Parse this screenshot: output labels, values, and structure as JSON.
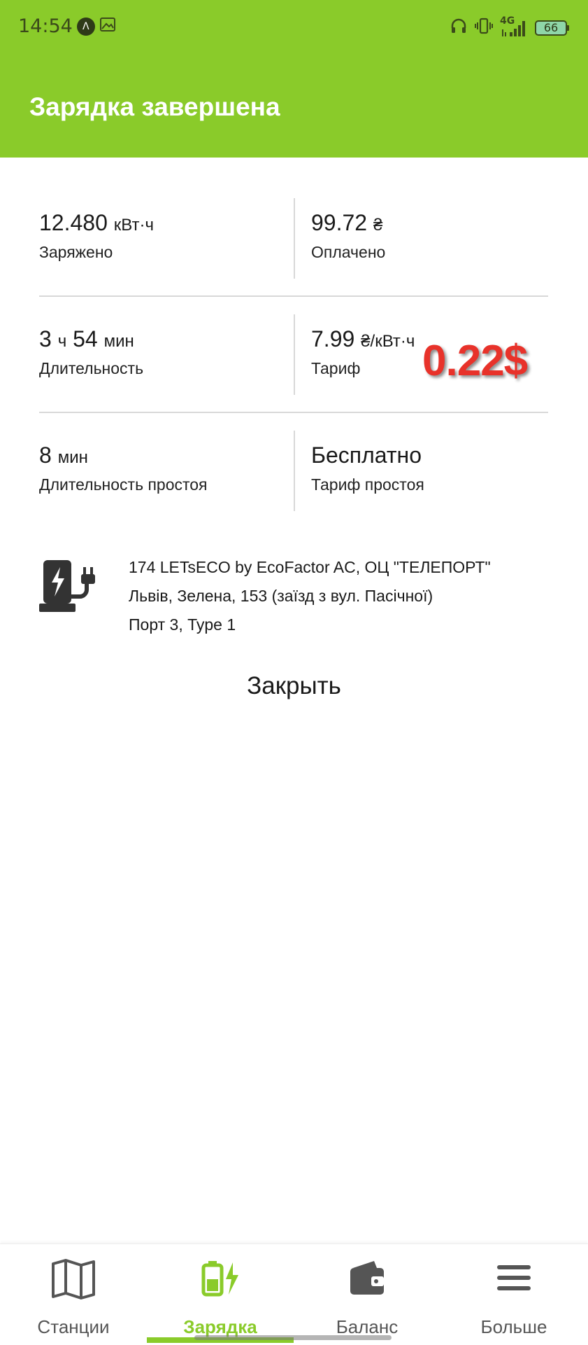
{
  "status_bar": {
    "time": "14:54",
    "badge_glyph": "Λ",
    "network": "4G",
    "battery": "66"
  },
  "header": {
    "title": "Зарядка завершена"
  },
  "stats": {
    "charged": {
      "value": "12.480",
      "unit": "кВт·ч",
      "label": "Заряжено"
    },
    "paid": {
      "value": "99.72",
      "unit": "₴",
      "label": "Оплачено"
    },
    "duration": {
      "hours": "3",
      "hours_unit": "ч",
      "minutes": "54",
      "minutes_unit": "мин",
      "label": "Длительность"
    },
    "tariff": {
      "value": "7.99",
      "unit": "₴/кВт·ч",
      "label": "Тариф",
      "usd_overlay": "0.22$"
    },
    "idle_duration": {
      "value": "8",
      "unit": "мин",
      "label": "Длительность простоя"
    },
    "idle_tariff": {
      "value": "Бесплатно",
      "label": "Тариф простоя"
    }
  },
  "station": {
    "name": "174 LETsECO by EcoFactor AC, ОЦ \"ТЕЛЕПОРТ\"",
    "address": "Львів, Зелена, 153 (заїзд з вул. Пасічної)",
    "port": "Порт 3, Type 1",
    "icon": "charging-station-icon"
  },
  "close_label": "Закрыть",
  "bottom_nav": {
    "items": [
      {
        "label": "Станции",
        "icon": "map-icon"
      },
      {
        "label": "Зарядка",
        "icon": "battery-charging-icon"
      },
      {
        "label": "Баланс",
        "icon": "wallet-icon"
      },
      {
        "label": "Больше",
        "icon": "menu-icon"
      }
    ],
    "active_index": 1
  },
  "colors": {
    "accent": "#8acb2a",
    "usd_overlay": "#e8322a",
    "text": "#1a1a1a",
    "divider": "#d8d8d8"
  }
}
